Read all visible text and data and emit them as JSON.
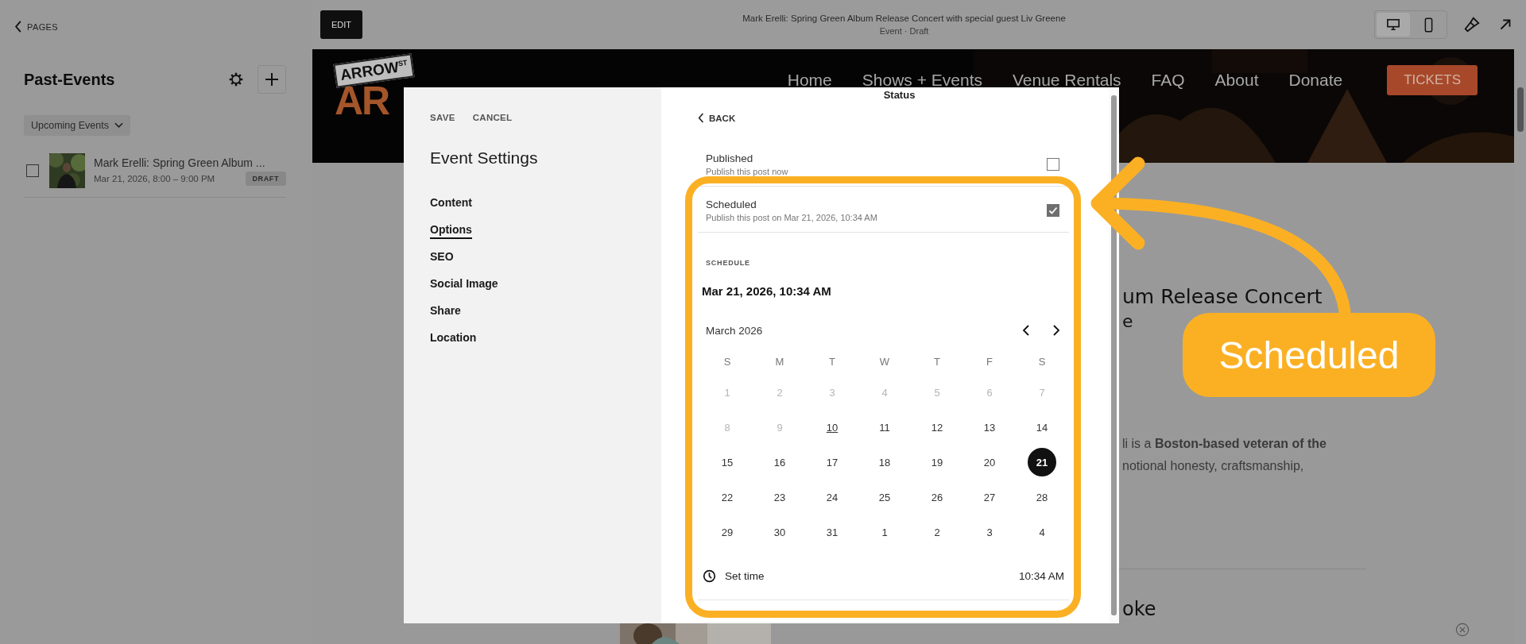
{
  "sidebar": {
    "back_link": "PAGES",
    "title": "Past-Events",
    "filter": "Upcoming Events",
    "items": [
      {
        "title": "Mark Erelli: Spring Green Album ...",
        "date": "Mar 21, 2026, 8:00 – 9:00 PM",
        "badge": "DRAFT",
        "checked": false
      }
    ]
  },
  "top_bar": {
    "edit_button": "EDIT",
    "title": "Mark Erelli: Spring Green Album Release Concert with special guest Liv Greene",
    "subtitle": "Event · Draft",
    "view_modes": [
      {
        "kind": "desktop",
        "selected": true
      },
      {
        "kind": "mobile",
        "selected": false
      }
    ]
  },
  "site": {
    "logo": {
      "top": "ARROW",
      "tag": "ST",
      "big": "AR"
    },
    "nav": [
      "Home",
      "Shows + Events",
      "Venue Rentals",
      "FAQ",
      "About",
      "Donate"
    ],
    "cta": "TICKETS",
    "heading": [
      "um Release Concert",
      "e"
    ],
    "body": [
      "li is a **Boston-based veteran of the**",
      "notional honesty, craftsmanship,"
    ],
    "next_heading": "oke"
  },
  "modal": {
    "save": "SAVE",
    "cancel": "CANCEL",
    "title": "Event Settings",
    "menu": [
      {
        "label": "Content",
        "selected": false
      },
      {
        "label": "Options",
        "selected": true
      },
      {
        "label": "SEO",
        "selected": false
      },
      {
        "label": "Social Image",
        "selected": false
      },
      {
        "label": "Share",
        "selected": false
      },
      {
        "label": "Location",
        "selected": false
      }
    ],
    "panel_title": "Status",
    "back": "BACK",
    "options": [
      {
        "label": "Published",
        "description": "Publish this post now",
        "checked": false
      },
      {
        "label": "Scheduled",
        "description": "Publish this post on Mar 21, 2026, 10:34 AM",
        "checked": true
      }
    ],
    "schedule_label": "SCHEDULE",
    "schedule_value": "Mar 21, 2026, 10:34 AM",
    "month": "March 2026",
    "weekdays": [
      "S",
      "M",
      "T",
      "W",
      "T",
      "F",
      "S"
    ],
    "weeks": [
      [
        {
          "label": "1",
          "muted": true,
          "underlined": false,
          "selected": false
        },
        {
          "label": "2",
          "muted": true,
          "underlined": false,
          "selected": false
        },
        {
          "label": "3",
          "muted": true,
          "underlined": false,
          "selected": false
        },
        {
          "label": "4",
          "muted": true,
          "underlined": false,
          "selected": false
        },
        {
          "label": "5",
          "muted": true,
          "underlined": false,
          "selected": false
        },
        {
          "label": "6",
          "muted": true,
          "underlined": false,
          "selected": false
        },
        {
          "label": "7",
          "muted": true,
          "underlined": false,
          "selected": false
        }
      ],
      [
        {
          "label": "8",
          "muted": true,
          "underlined": false,
          "selected": false
        },
        {
          "label": "9",
          "muted": true,
          "underlined": false,
          "selected": false
        },
        {
          "label": "10",
          "muted": false,
          "underlined": true,
          "selected": false
        },
        {
          "label": "11",
          "muted": false,
          "underlined": false,
          "selected": false
        },
        {
          "label": "12",
          "muted": false,
          "underlined": false,
          "selected": false
        },
        {
          "label": "13",
          "muted": false,
          "underlined": false,
          "selected": false
        },
        {
          "label": "14",
          "muted": false,
          "underlined": false,
          "selected": false
        }
      ],
      [
        {
          "label": "15",
          "muted": false,
          "underlined": false,
          "selected": false
        },
        {
          "label": "16",
          "muted": false,
          "underlined": false,
          "selected": false
        },
        {
          "label": "17",
          "muted": false,
          "underlined": false,
          "selected": false
        },
        {
          "label": "18",
          "muted": false,
          "underlined": false,
          "selected": false
        },
        {
          "label": "19",
          "muted": false,
          "underlined": false,
          "selected": false
        },
        {
          "label": "20",
          "muted": false,
          "underlined": false,
          "selected": false
        },
        {
          "label": "21",
          "muted": false,
          "underlined": false,
          "selected": true
        }
      ],
      [
        {
          "label": "22",
          "muted": false,
          "underlined": false,
          "selected": false
        },
        {
          "label": "23",
          "muted": false,
          "underlined": false,
          "selected": false
        },
        {
          "label": "24",
          "muted": false,
          "underlined": false,
          "selected": false
        },
        {
          "label": "25",
          "muted": false,
          "underlined": false,
          "selected": false
        },
        {
          "label": "26",
          "muted": false,
          "underlined": false,
          "selected": false
        },
        {
          "label": "27",
          "muted": false,
          "underlined": false,
          "selected": false
        },
        {
          "label": "28",
          "muted": false,
          "underlined": false,
          "selected": false
        }
      ],
      [
        {
          "label": "29",
          "muted": false,
          "underlined": false,
          "selected": false
        },
        {
          "label": "30",
          "muted": false,
          "underlined": false,
          "selected": false
        },
        {
          "label": "31",
          "muted": false,
          "underlined": false,
          "selected": false
        },
        {
          "label": "1",
          "muted": false,
          "underlined": false,
          "selected": false
        },
        {
          "label": "2",
          "muted": false,
          "underlined": false,
          "selected": false
        },
        {
          "label": "3",
          "muted": false,
          "underlined": false,
          "selected": false
        },
        {
          "label": "4",
          "muted": false,
          "underlined": false,
          "selected": false
        }
      ]
    ],
    "set_time_label": "Set time",
    "time": "10:34 AM"
  },
  "annotation": {
    "label": "Scheduled"
  }
}
